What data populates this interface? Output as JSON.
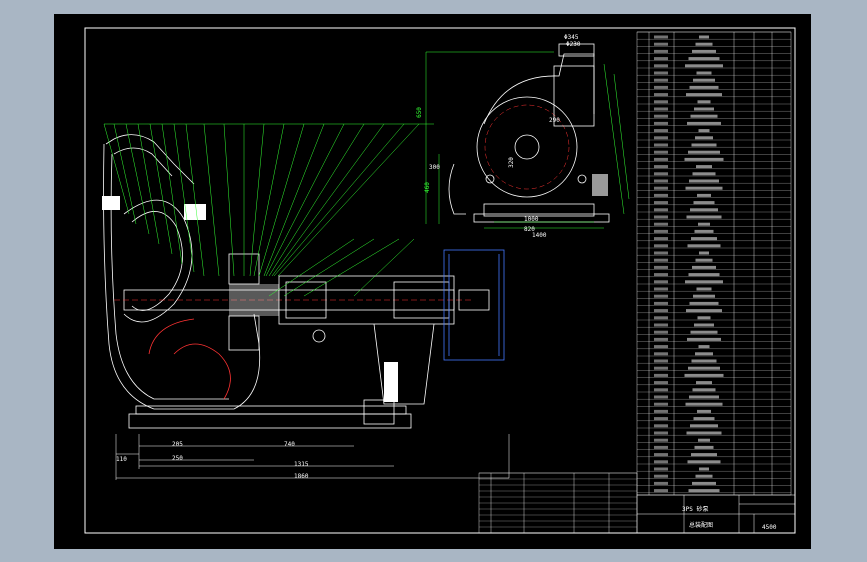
{
  "drawing": {
    "title_block": {
      "product": "3PS 砂泵",
      "sheet": "总装配图",
      "code": "4500"
    },
    "dimensions": {
      "lengths": [
        "110",
        "205",
        "250",
        "740",
        "1315",
        "1860"
      ],
      "side_view": [
        "650",
        "460",
        "290",
        "820",
        "1400",
        "1000",
        "320",
        "300"
      ],
      "flange": [
        "Φ345",
        "Φ230"
      ]
    }
  }
}
